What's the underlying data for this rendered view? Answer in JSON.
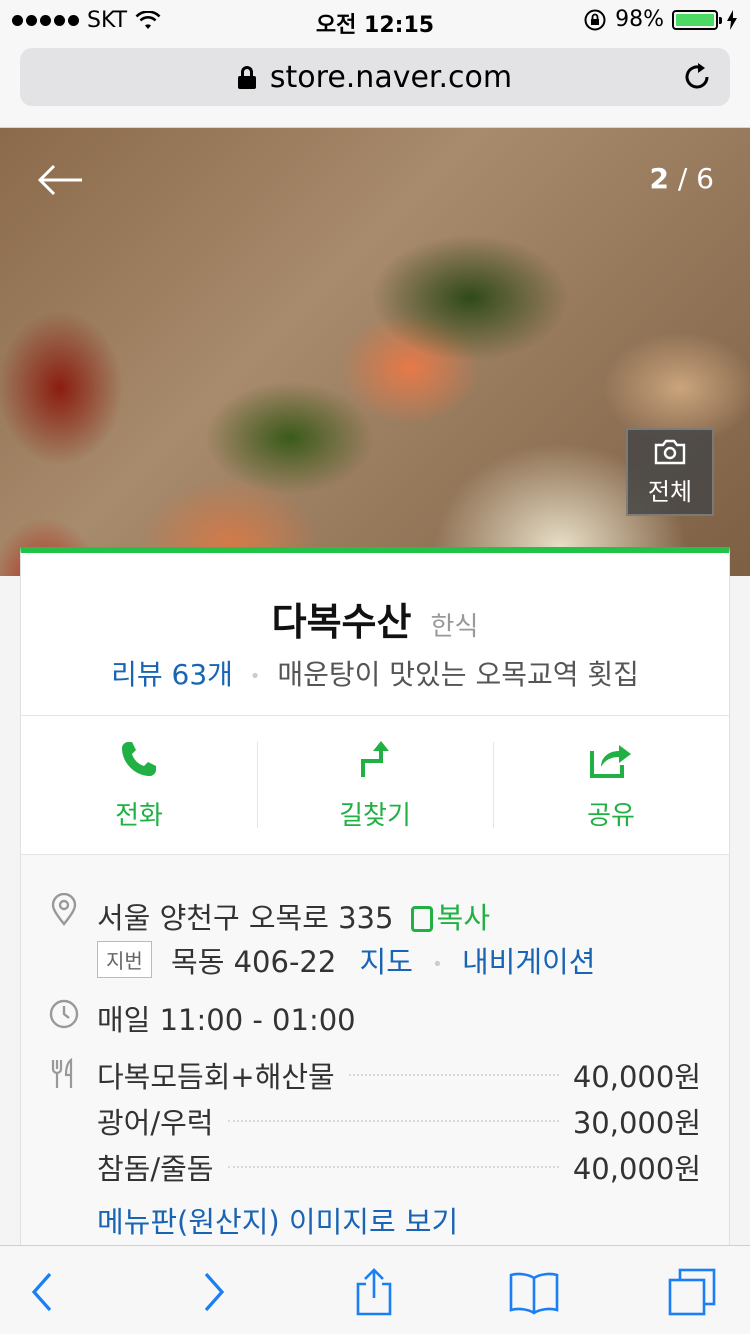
{
  "status": {
    "carrier": "SKT",
    "time": "오전 12:15",
    "battery": "98%"
  },
  "browser": {
    "url": "store.naver.com"
  },
  "photo": {
    "current": "2",
    "total": "/ 6",
    "all_label": "전체"
  },
  "place": {
    "name": "다복수산",
    "category": "한식",
    "review": "리뷰 63개",
    "description": "매운탕이 맛있는 오목교역 횟집"
  },
  "actions": [
    {
      "label": "전화"
    },
    {
      "label": "길찾기"
    },
    {
      "label": "공유"
    }
  ],
  "info": {
    "address": "서울 양천구 오목로 335",
    "copy_label": "복사",
    "jibun_badge": "지번",
    "jibun_address": "목동 406-22",
    "map_link": "지도",
    "navi_link": "내비게이션",
    "hours": "매일 11:00 - 01:00",
    "menu": [
      {
        "name": "다복모듬회+해산물",
        "price": "40,000원"
      },
      {
        "name": "광어/우럭",
        "price": "30,000원"
      },
      {
        "name": "참돔/줄돔",
        "price": "40,000원"
      }
    ],
    "menu_link": "메뉴판(원산지) 이미지로 보기"
  },
  "colors": {
    "accent_green": "#21c247",
    "link_blue": "#1a64b4"
  }
}
